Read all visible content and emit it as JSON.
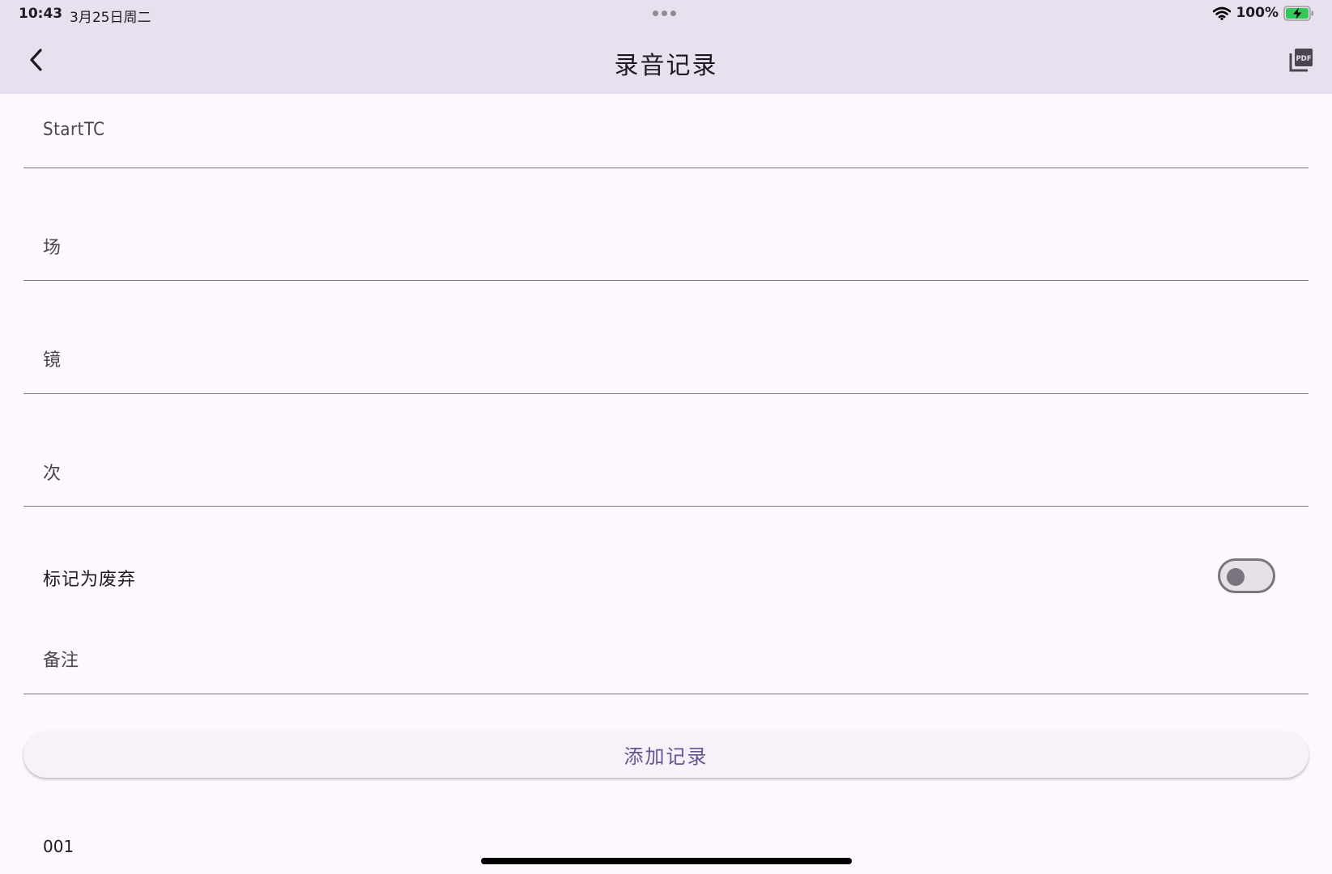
{
  "status_bar": {
    "time": "10:43",
    "date": "3月25日周二",
    "battery": "100%"
  },
  "header": {
    "title": "录音记录",
    "back_icon": "chevron-left-icon",
    "pdf_icon": "pdf-export-icon"
  },
  "form": {
    "start_tc_label": "StartTC",
    "scene_label": "场",
    "shot_label": "镜",
    "take_label": "次",
    "discard_label": "标记为废弃",
    "discard_on": false,
    "notes_label": "备注"
  },
  "actions": {
    "add_record_label": "添加记录"
  },
  "records": [
    {
      "label": "001"
    }
  ],
  "colors": {
    "bar_background": "#e9e0ef",
    "page_background": "#fdf7fe",
    "accent": "#65558f",
    "outline": "#79747e"
  }
}
